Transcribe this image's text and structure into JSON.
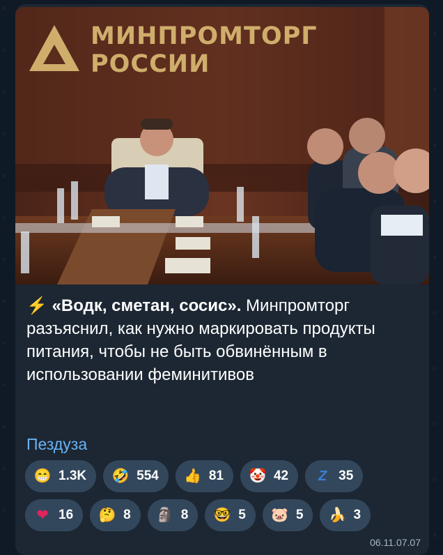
{
  "post": {
    "logo_line1": "МИНПРОМТОРГ",
    "logo_line2": "РОССИИ",
    "bolt": "⚡",
    "headline": "«Водк, сметан, сосис».",
    "body": " Минпромторг разъяснил, как нужно маркировать продукты питания, чтобы не быть обвинённым в использовании феминитивов",
    "link": "Пездуза",
    "timestamp": "06.11.07.07"
  },
  "reactions": [
    [
      {
        "icon": "grinning-face-icon",
        "glyph": "😁",
        "count": "1.3K"
      },
      {
        "icon": "rolling-laughing-face-icon",
        "glyph": "🤣",
        "count": "554"
      },
      {
        "icon": "thumbs-up-icon",
        "glyph": "👍",
        "count": "81"
      },
      {
        "icon": "clown-face-icon",
        "glyph": "🤡",
        "count": "42"
      },
      {
        "icon": "z-letter-icon",
        "glyph": "Z",
        "count": "35"
      }
    ],
    [
      {
        "icon": "red-heart-icon",
        "glyph": "❤",
        "count": "16"
      },
      {
        "icon": "thinking-face-icon",
        "glyph": "🤔",
        "count": "8"
      },
      {
        "icon": "moai-icon",
        "glyph": "🗿",
        "count": "8"
      },
      {
        "icon": "nerd-face-icon",
        "glyph": "🤓",
        "count": "5"
      },
      {
        "icon": "pig-face-icon",
        "glyph": "🐷",
        "count": "5"
      },
      {
        "icon": "banana-icon",
        "glyph": "🍌",
        "count": "3"
      }
    ]
  ],
  "colors": {
    "background": "#0f1a26",
    "bubble": "#1c2733",
    "chip": "#33475c",
    "link": "#6ab2f2"
  }
}
